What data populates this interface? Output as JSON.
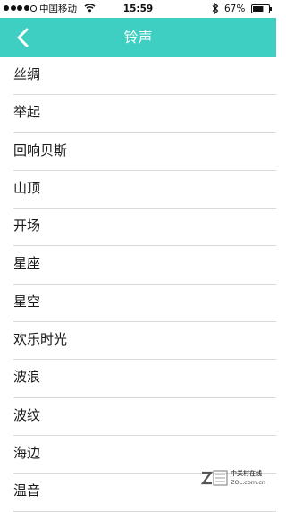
{
  "status_bar": {
    "signal_filled": 4,
    "signal_total": 5,
    "carrier": "中国移动",
    "wifi_icon": "wifi-icon",
    "time": "15:59",
    "bluetooth_icon": "bluetooth-icon",
    "battery_percent": "67%",
    "battery_level": 0.67
  },
  "nav_bar": {
    "title": "铃声",
    "back_icon": "chevron-left-icon",
    "color": "#3ecfc2"
  },
  "ringtones": [
    {
      "label": "丝绸"
    },
    {
      "label": "举起"
    },
    {
      "label": "回响贝斯"
    },
    {
      "label": "山顶"
    },
    {
      "label": "开场"
    },
    {
      "label": "星座"
    },
    {
      "label": "星空"
    },
    {
      "label": "欢乐时光"
    },
    {
      "label": "波浪"
    },
    {
      "label": "波纹"
    },
    {
      "label": "海边"
    },
    {
      "label": "温音"
    }
  ],
  "watermark": {
    "chinese": "中关村在线",
    "english": "ZOL.com.cn"
  }
}
